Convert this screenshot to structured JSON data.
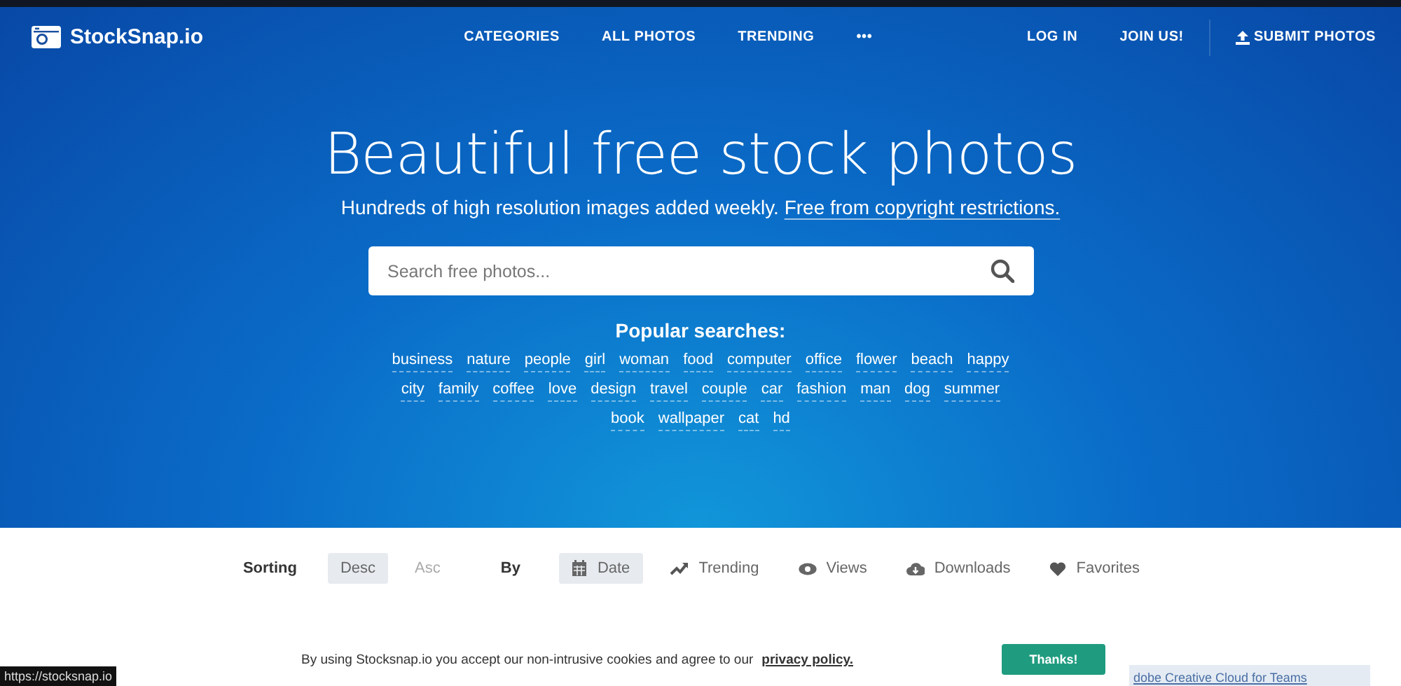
{
  "header": {
    "logo": "StockSnap.io",
    "nav": [
      "CATEGORIES",
      "ALL PHOTOS",
      "TRENDING",
      "•••"
    ],
    "account": [
      "LOG IN",
      "JOIN US!"
    ],
    "submit": "SUBMIT PHOTOS"
  },
  "hero": {
    "title": "Beautiful free stock photos",
    "subtitle": "Hundreds of high resolution images added weekly.",
    "subtitle_link": "Free from copyright restrictions.",
    "search": {
      "placeholder": "Search free photos..."
    },
    "popular": {
      "title": "Popular searches:",
      "tags": [
        "business",
        "nature",
        "people",
        "girl",
        "woman",
        "food",
        "computer",
        "office",
        "flower",
        "beach",
        "happy",
        "city",
        "family",
        "coffee",
        "love",
        "design",
        "travel",
        "couple",
        "car",
        "fashion",
        "man",
        "dog",
        "summer",
        "book",
        "wallpaper",
        "cat",
        "hd"
      ]
    }
  },
  "sorting": {
    "label": "Sorting",
    "order": [
      {
        "label": "Desc",
        "selected": true
      },
      {
        "label": "Asc",
        "selected": false
      }
    ],
    "by_label": "By",
    "by": [
      {
        "label": "Date",
        "selected": true
      },
      {
        "label": "Trending",
        "selected": false
      },
      {
        "label": "Views",
        "selected": false
      },
      {
        "label": "Downloads",
        "selected": false
      },
      {
        "label": "Favorites",
        "selected": false
      }
    ]
  },
  "cookie_bar": {
    "text": "By using Stocksnap.io you accept our non-intrusive cookies and agree to our",
    "link": "privacy policy.",
    "button": "Thanks!"
  },
  "ad_text": "dobe Creative Cloud for Teams",
  "status_url": "https://stocksnap.io"
}
